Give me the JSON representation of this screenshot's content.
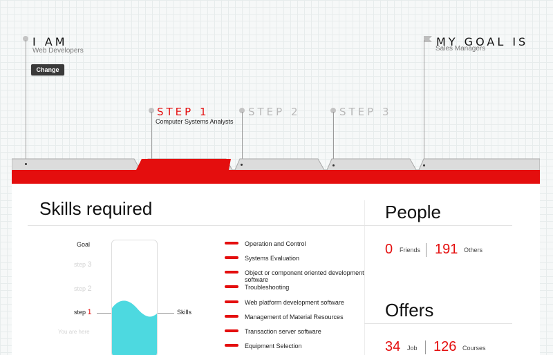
{
  "header": {
    "i_am": {
      "title": "I AM",
      "subtitle": "Web Developers",
      "button_label": "Change"
    },
    "goal": {
      "title": "MY GOAL IS",
      "subtitle": "Sales Managers"
    },
    "steps": [
      {
        "label": "STEP 1",
        "subtitle": "Computer Systems Analysts",
        "active": true
      },
      {
        "label": "STEP 2",
        "subtitle": "",
        "active": false
      },
      {
        "label": "STEP 3",
        "subtitle": "",
        "active": false
      }
    ],
    "accent_color": "#e40e0e"
  },
  "skills": {
    "title": "Skills required",
    "levels": [
      {
        "label": "Goal",
        "num": ""
      },
      {
        "label": "step",
        "num": "3"
      },
      {
        "label": "step",
        "num": "2"
      },
      {
        "label": "step",
        "num": "1"
      },
      {
        "label": "You are here",
        "num": ""
      }
    ],
    "gauge_label": "Skills",
    "gauge_fill_color": "#4dd9e0",
    "items": [
      "Operation and Control",
      "Systems Evaluation",
      "Object or component oriented development software",
      "Troubleshooting",
      "Web platform development software",
      "Management of Material Resources",
      "Transaction server software",
      "Equipment Selection"
    ]
  },
  "people": {
    "title": "People",
    "friends_count": "0",
    "friends_label": "Friends",
    "others_count": "191",
    "others_label": "Others"
  },
  "offers": {
    "title": "Offers",
    "job_count": "34",
    "job_label": "Job",
    "courses_count": "126",
    "courses_label": "Courses"
  }
}
